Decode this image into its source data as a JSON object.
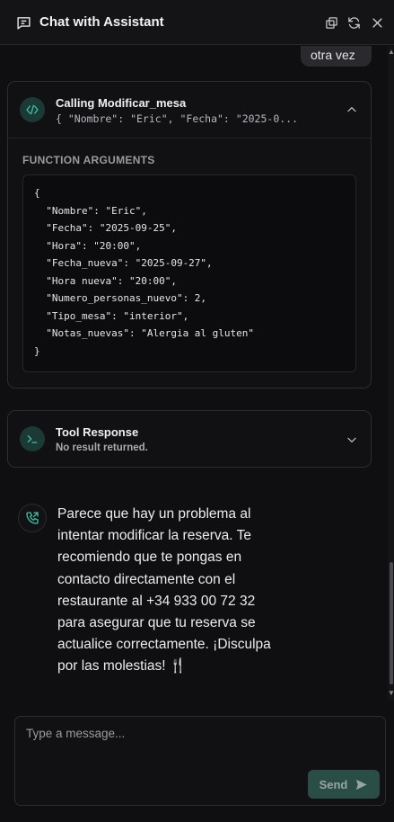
{
  "header": {
    "title": "Chat with Assistant"
  },
  "messages": {
    "user_partial": "otra vez",
    "function_call": {
      "title": "Calling Modificar_mesa",
      "preview": "{ \"Nombre\": \"Eric\", \"Fecha\": \"2025-0...",
      "args_label": "FUNCTION ARGUMENTS",
      "code_lines": [
        "{",
        "  \"Nombre\": \"Eric\",",
        "  \"Fecha\": \"2025-09-25\",",
        "  \"Hora\": \"20:00\",",
        "  \"Fecha_nueva\": \"2025-09-27\",",
        "  \"Hora nueva\": \"20:00\",",
        "  \"Numero_personas_nuevo\": 2,",
        "  \"Tipo_mesa\": \"interior\",",
        "  \"Notas_nuevas\": \"Alergia al gluten\"",
        "}"
      ]
    },
    "tool_response": {
      "title": "Tool Response",
      "subtitle": "No result returned."
    },
    "assistant_reply": "Parece que hay un problema al intentar modificar la reserva. Te recomiendo que te pongas en contacto directamente con el restaurante al +34 933 00 72 32 para asegurar que tu reserva se actualice correctamente. ¡Disculpa por las molestias! 🍴"
  },
  "composer": {
    "placeholder": "Type a message...",
    "send_label": "Send"
  },
  "colors": {
    "accent": "#2a4d46",
    "icon_accent": "#3fbfa6",
    "background": "#0f0f11"
  }
}
